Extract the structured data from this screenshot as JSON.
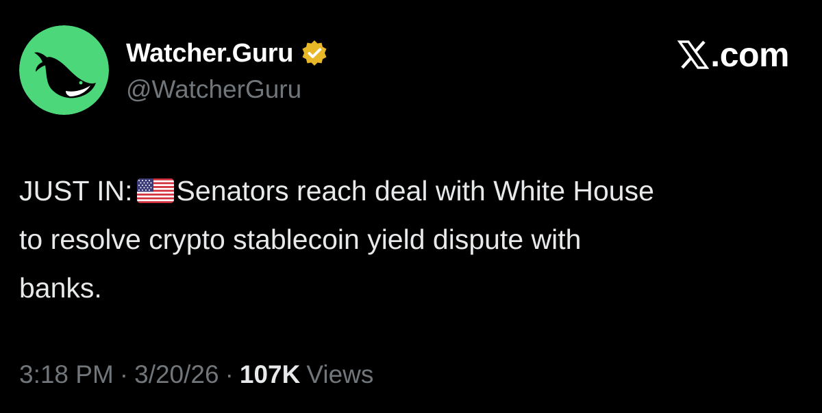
{
  "tweet": {
    "author": {
      "display_name": "Watcher.Guru",
      "handle": "@WatcherGuru",
      "avatar_icon": "whale-icon",
      "avatar_bg": "#4cd87a",
      "verified_badge": "gold-verified-badge-icon",
      "badge_color": "#e8b829"
    },
    "source": {
      "logo_icon": "x-logo-icon",
      "domain": ".com"
    },
    "text": {
      "line1_prefix": "JUST IN:",
      "flag_icon": "us-flag-icon",
      "line1_suffix": "Senators reach deal with White House",
      "line2": "to resolve crypto stablecoin yield dispute with",
      "line3": "banks."
    },
    "meta": {
      "time": "3:18 PM",
      "separator": "·",
      "date": "3/20/26",
      "views_count": "107K",
      "views_label": "Views"
    }
  }
}
